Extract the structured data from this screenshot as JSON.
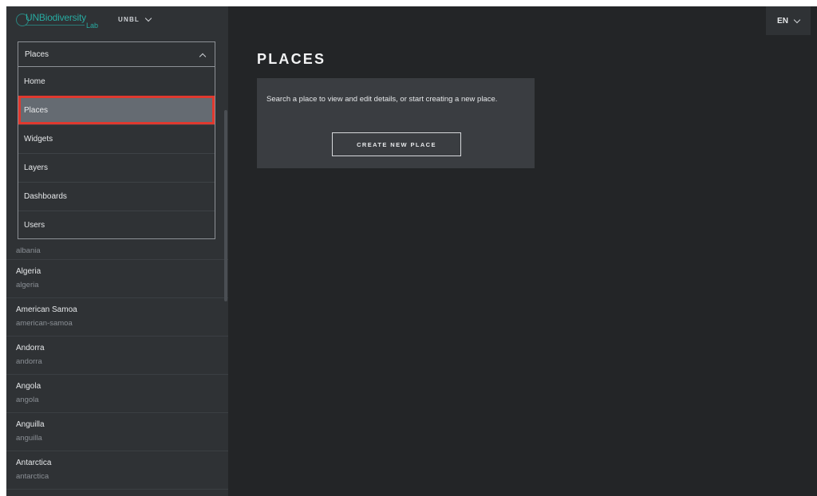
{
  "brand": {
    "logo_text": "UNBiodiversity",
    "logo_sub": "Lab",
    "site_label": "UNBL"
  },
  "nav_select": {
    "value": "Places"
  },
  "menu": {
    "items": [
      {
        "label": "Home"
      },
      {
        "label": "Places"
      },
      {
        "label": "Widgets"
      },
      {
        "label": "Layers"
      },
      {
        "label": "Dashboards"
      },
      {
        "label": "Users"
      }
    ]
  },
  "places": [
    {
      "slug": "albania"
    },
    {
      "name": "Algeria",
      "slug": "algeria"
    },
    {
      "name": "American Samoa",
      "slug": "american-samoa"
    },
    {
      "name": "Andorra",
      "slug": "andorra"
    },
    {
      "name": "Angola",
      "slug": "angola"
    },
    {
      "name": "Anguilla",
      "slug": "anguilla"
    },
    {
      "name": "Antarctica",
      "slug": "antarctica"
    }
  ],
  "header": {
    "language": "EN"
  },
  "main": {
    "title": "PLACES",
    "description": "Search a place to view and edit details, or start creating a new place.",
    "create_button": "CREATE NEW PLACE"
  },
  "colors": {
    "accent": "#27aba1",
    "highlight": "#e0392f",
    "background": "#232527",
    "sidebar": "#2f3235"
  }
}
